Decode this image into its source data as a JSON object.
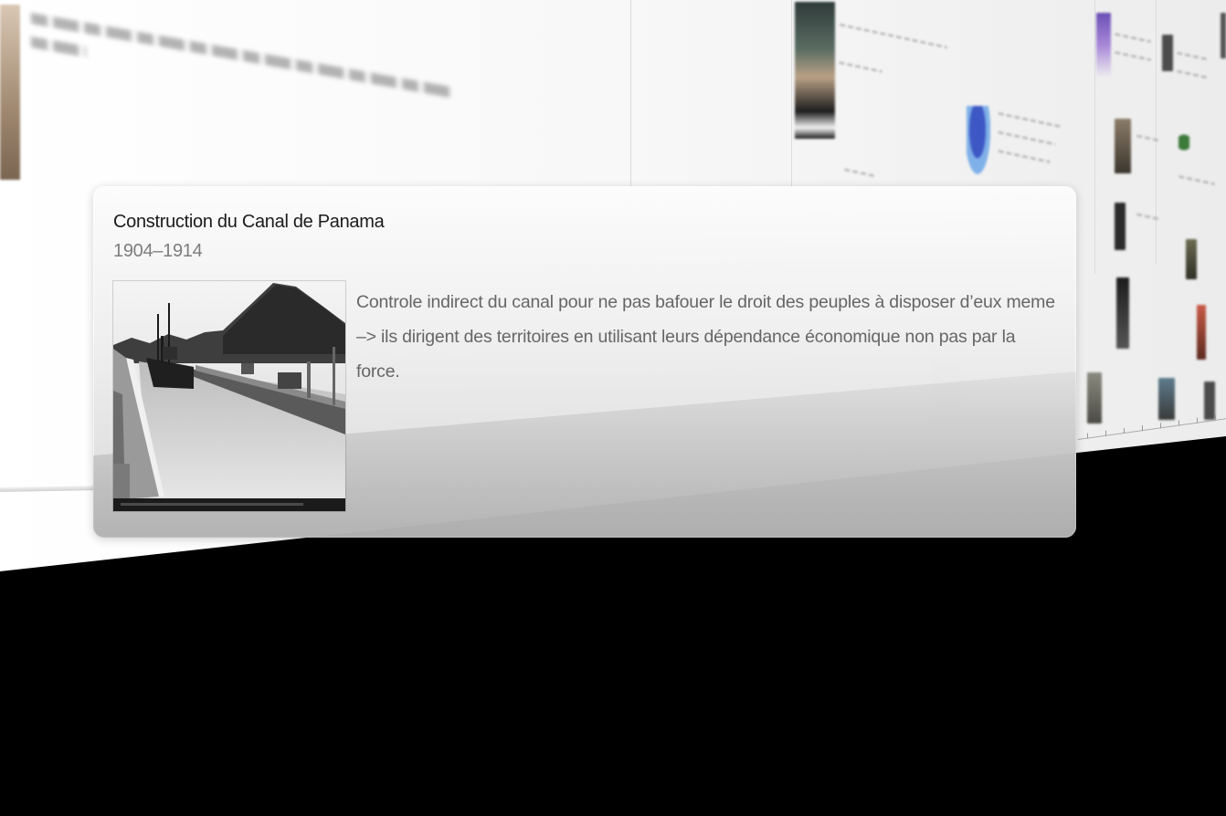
{
  "popup": {
    "title": "Construction du Canal de Panama",
    "date_range": "1904–1914",
    "image_label": "panama-canal-photo",
    "description": "Controle indirect du canal pour ne pas bafouer le droit des peuples à disposer d’eux meme –> ils dirigent des territoires en utilisant leurs dépendance économique non pas par la force."
  },
  "colors": {
    "background": "#000000",
    "wall": "#f5f5f5",
    "card_title": "#1b1b1b",
    "card_date": "#7d7d7d",
    "card_text": "#666666"
  },
  "icons": {
    "timeline_items": [
      "portrait-photo",
      "map-thumbnail",
      "silhouette-figure",
      "archive-photo"
    ]
  }
}
